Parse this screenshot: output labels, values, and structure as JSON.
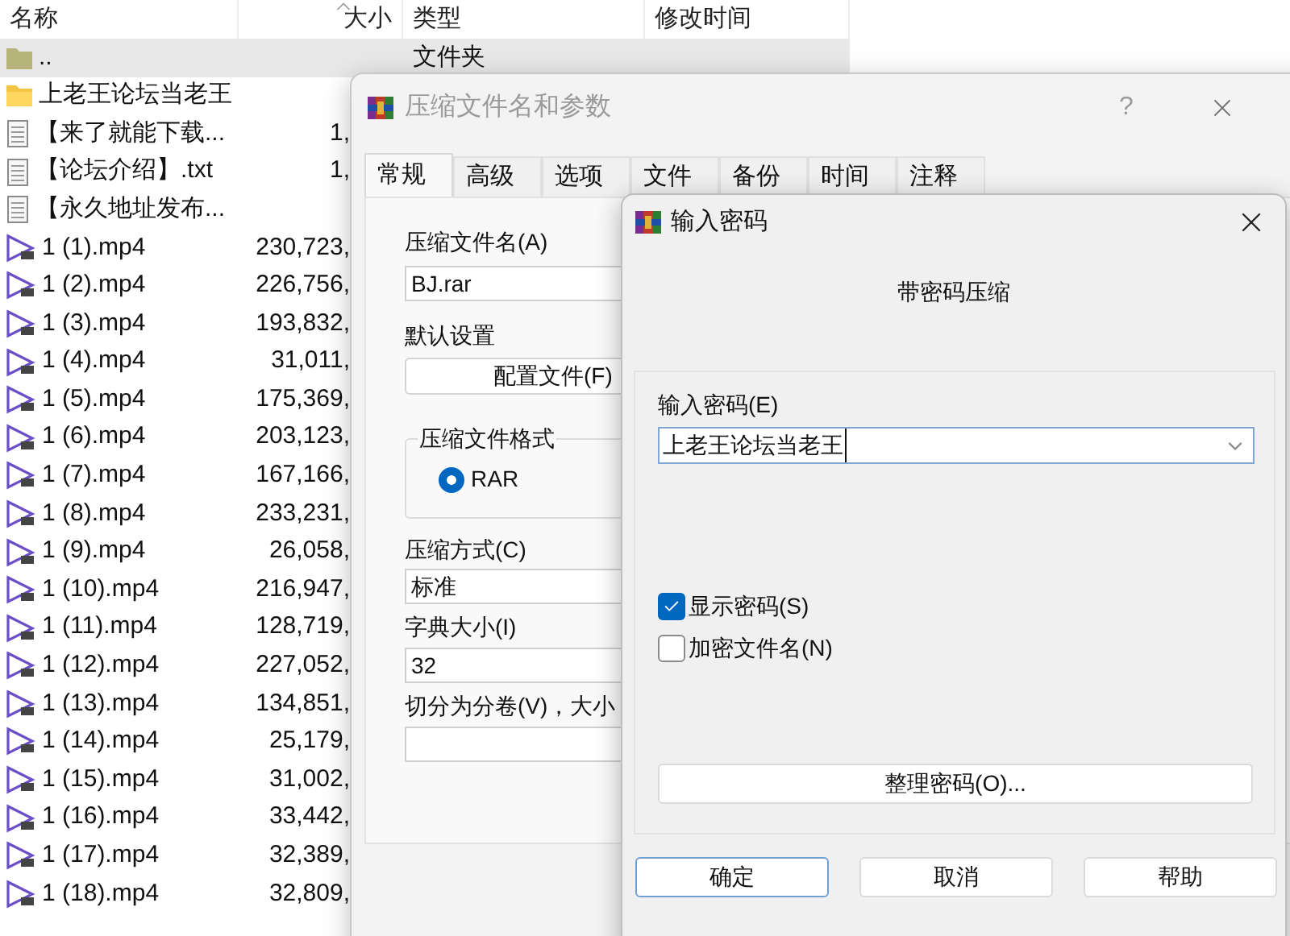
{
  "file_list": {
    "columns": [
      "名称",
      "大小",
      "类型",
      "修改时间"
    ],
    "rows": [
      {
        "kind": "parent",
        "name": "..",
        "type": "文件夹",
        "selected": true
      },
      {
        "kind": "folder",
        "name": "上老王论坛当老王",
        "selected": false
      },
      {
        "kind": "text",
        "name": "【来了就能下载...",
        "size": "1,",
        "selected": false
      },
      {
        "kind": "text",
        "name": "【论坛介绍】.txt",
        "size": "1,",
        "selected": false
      },
      {
        "kind": "text",
        "name": "【永久地址发布...",
        "selected": false
      },
      {
        "kind": "video",
        "name": "1 (1).mp4",
        "size": "230,723,",
        "selected": false
      },
      {
        "kind": "video",
        "name": "1 (2).mp4",
        "size": "226,756,",
        "selected": false
      },
      {
        "kind": "video",
        "name": "1 (3).mp4",
        "size": "193,832,",
        "selected": false
      },
      {
        "kind": "video",
        "name": "1 (4).mp4",
        "size": "31,011,",
        "selected": false
      },
      {
        "kind": "video",
        "name": "1 (5).mp4",
        "size": "175,369,",
        "selected": false
      },
      {
        "kind": "video",
        "name": "1 (6).mp4",
        "size": "203,123,",
        "selected": false
      },
      {
        "kind": "video",
        "name": "1 (7).mp4",
        "size": "167,166,",
        "selected": false
      },
      {
        "kind": "video",
        "name": "1 (8).mp4",
        "size": "233,231,",
        "selected": false
      },
      {
        "kind": "video",
        "name": "1 (9).mp4",
        "size": "26,058,",
        "selected": false
      },
      {
        "kind": "video",
        "name": "1 (10).mp4",
        "size": "216,947,",
        "selected": false
      },
      {
        "kind": "video",
        "name": "1 (11).mp4",
        "size": "128,719,",
        "selected": false
      },
      {
        "kind": "video",
        "name": "1 (12).mp4",
        "size": "227,052,",
        "selected": false
      },
      {
        "kind": "video",
        "name": "1 (13).mp4",
        "size": "134,851,",
        "selected": false
      },
      {
        "kind": "video",
        "name": "1 (14).mp4",
        "size": "25,179,",
        "selected": false
      },
      {
        "kind": "video",
        "name": "1 (15).mp4",
        "size": "31,002,",
        "selected": false
      },
      {
        "kind": "video",
        "name": "1 (16).mp4",
        "size": "33,442,",
        "selected": false
      },
      {
        "kind": "video",
        "name": "1 (17).mp4",
        "size": "32,389,",
        "selected": false
      },
      {
        "kind": "video",
        "name": "1 (18).mp4",
        "size": "32,809,",
        "selected": false
      }
    ]
  },
  "archive_dialog": {
    "title": "压缩文件名和参数",
    "help": "?",
    "tabs": [
      {
        "label": "常规",
        "selected": true
      },
      {
        "label": "高级",
        "selected": false
      },
      {
        "label": "选项",
        "selected": false
      },
      {
        "label": "文件",
        "selected": false
      },
      {
        "label": "备份",
        "selected": false
      },
      {
        "label": "时间",
        "selected": false
      },
      {
        "label": "注释",
        "selected": false
      }
    ],
    "archive_name_label": "压缩文件名(A)",
    "archive_name": "BJ.rar",
    "profile_label": "默认设置",
    "profile_button": "配置文件(F)",
    "format_group": {
      "title": "压缩文件格式",
      "options": [
        {
          "label": "RAR",
          "selected": true
        }
      ]
    },
    "method_label": "压缩方式(C)",
    "method": "标准",
    "dictionary_label": "字典大小(I)",
    "dictionary": "32",
    "split_label": "切分为分卷(V)，大小"
  },
  "password_dialog": {
    "title": "输入密码",
    "heading": "带密码压缩",
    "password_label": "输入密码(E)",
    "password": "上老王论坛当老王",
    "options": [
      {
        "label": "显示密码(S)",
        "checked": true
      },
      {
        "label": "加密文件名(N)",
        "checked": false
      }
    ],
    "organize_button": "整理密码(O)...",
    "buttons": [
      {
        "label": "确定",
        "selected": true
      },
      {
        "label": "取消",
        "selected": false
      },
      {
        "label": "帮助",
        "selected": false
      }
    ]
  }
}
